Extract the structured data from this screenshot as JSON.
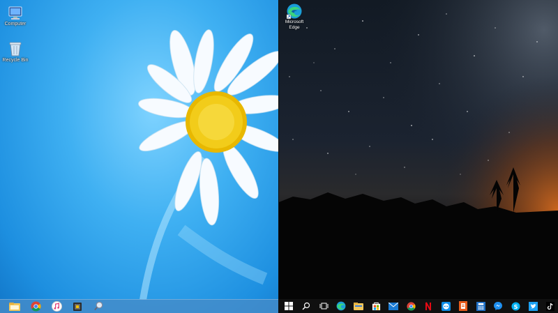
{
  "left_desktop": {
    "icons": [
      {
        "label": "Computer",
        "icon": "computer-icon"
      },
      {
        "label": "Recycle Bin",
        "icon": "recycle-bin-icon"
      }
    ],
    "taskbar": [
      "file-explorer-icon",
      "chrome-icon",
      "itunes-icon",
      "app-icon",
      "magnifier-icon"
    ],
    "colors": {
      "sky": "#3fb0f2",
      "taskbar": "#468cc8",
      "petal": "#ffffff",
      "flower_center": "#f2c200"
    }
  },
  "right_desktop": {
    "icons": [
      {
        "label_line1": "Microsoft",
        "label_line2": "Edge",
        "icon": "edge-icon"
      }
    ],
    "taskbar": [
      "start-icon",
      "search-icon",
      "task-view-icon",
      "edge-icon",
      "file-explorer-icon",
      "store-icon",
      "mail-icon",
      "chrome-icon",
      "netflix-icon",
      "teamviewer-icon",
      "office-icon",
      "calculator-icon",
      "messenger-icon",
      "skype-icon",
      "twitter-icon",
      "tiktok-icon"
    ],
    "colors": {
      "night_sky": "#1b2330",
      "taskbar": "#101010",
      "horizon_glow": "#c2621d"
    }
  }
}
